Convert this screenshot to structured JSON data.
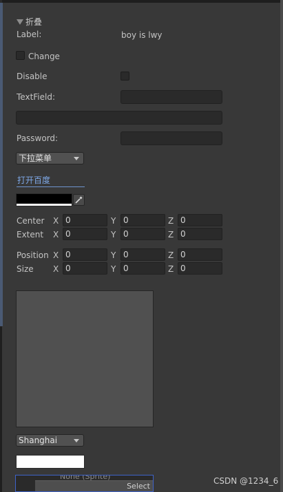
{
  "foldout": {
    "label": "折叠"
  },
  "label_row": {
    "label": "Label:",
    "value": "boy is lwy"
  },
  "change_toggle": {
    "label": "Change"
  },
  "disable_row": {
    "label": "Disable"
  },
  "textfield_row": {
    "label": "TextField:",
    "value": ""
  },
  "wide_field": {
    "value": ""
  },
  "password_row": {
    "label": "Password:",
    "value": ""
  },
  "menu_dropdown": {
    "selected": "下拉菜单"
  },
  "link": {
    "label": "打开百度"
  },
  "color_field": {
    "color": "#000000"
  },
  "bounds": {
    "center_label": "Center",
    "extent_label": "Extent",
    "axis_x": "X",
    "axis_y": "Y",
    "axis_z": "Z",
    "center": {
      "x": "0",
      "y": "0",
      "z": "0"
    },
    "extent": {
      "x": "0",
      "y": "0",
      "z": "0"
    }
  },
  "transform": {
    "position_label": "Position",
    "size_label": "Size",
    "position": {
      "x": "0",
      "y": "0",
      "z": "0"
    },
    "size": {
      "x": "0",
      "y": "0",
      "z": "0"
    }
  },
  "city_dropdown": {
    "selected": "Shanghai"
  },
  "object_field": {
    "value": "None (Sprite)",
    "select_label": "Select"
  },
  "watermark": {
    "text": "CSDN @1234_6"
  },
  "colors": {
    "background": "#383838",
    "field": "#2a2a2a",
    "link": "#7fa9e8",
    "preview": "#505050"
  }
}
